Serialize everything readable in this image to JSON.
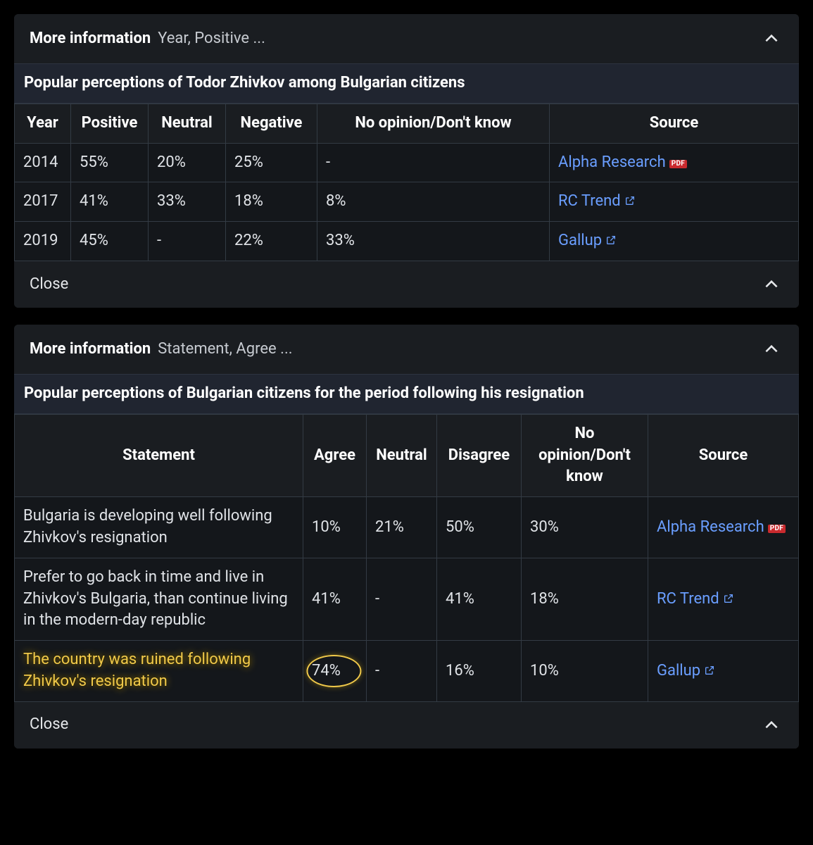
{
  "panel1": {
    "header_bold": "More information",
    "header_rest": "Year, Positive ...",
    "table_title": "Popular perceptions of Todor Zhivkov among Bulgarian citizens",
    "headers": [
      "Year",
      "Positive",
      "Neutral",
      "Negative",
      "No opinion/Don't know",
      "Source"
    ],
    "rows": [
      {
        "year": "2014",
        "positive": "55%",
        "neutral": "20%",
        "negative": "25%",
        "no_op": "-",
        "source": "Alpha Research",
        "icon": "pdf"
      },
      {
        "year": "2017",
        "positive": "41%",
        "neutral": "33%",
        "negative": "18%",
        "no_op": "8%",
        "source": "RC Trend",
        "icon": "ext"
      },
      {
        "year": "2019",
        "positive": "45%",
        "neutral": "-",
        "negative": "22%",
        "no_op": "33%",
        "source": "Gallup",
        "icon": "ext"
      }
    ],
    "close": "Close"
  },
  "panel2": {
    "header_bold": "More information",
    "header_rest": "Statement, Agree ...",
    "table_title": "Popular perceptions of Bulgarian citizens for the period following his resignation",
    "headers": [
      "Statement",
      "Agree",
      "Neutral",
      "Disagree",
      "No opinion/Don't know",
      "Source"
    ],
    "rows": [
      {
        "statement": "Bulgaria is developing well following Zhivkov's resignation",
        "agree": "10%",
        "neutral": "21%",
        "disagree": "50%",
        "no_op": "30%",
        "source": "Alpha Research",
        "icon": "pdf",
        "highlight": false
      },
      {
        "statement": "Prefer to go back in time and live in Zhivkov's Bulgaria, than continue living in the modern-day republic",
        "agree": "41%",
        "neutral": "-",
        "disagree": "41%",
        "no_op": "18%",
        "source": "RC Trend",
        "icon": "ext",
        "highlight": false
      },
      {
        "statement": "The country was ruined following Zhivkov's resignation",
        "agree": "74%",
        "neutral": "-",
        "disagree": "16%",
        "no_op": "10%",
        "source": "Gallup",
        "icon": "ext",
        "highlight": true
      }
    ],
    "close": "Close"
  },
  "icons": {
    "pdf_label": "PDF"
  }
}
